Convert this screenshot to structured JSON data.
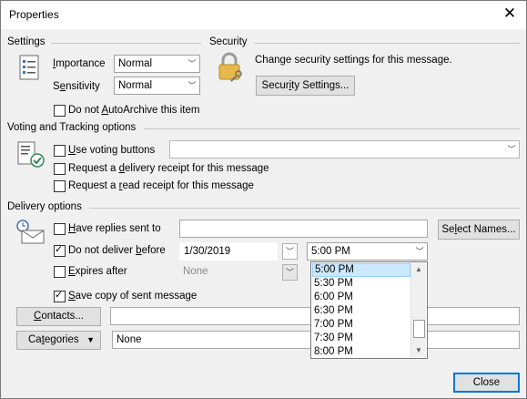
{
  "window": {
    "title": "Properties",
    "close_glyph": "✕"
  },
  "settings": {
    "heading": "Settings",
    "importance_pre": "",
    "importance_u": "I",
    "importance_post": "mportance",
    "importance_value": "Normal",
    "sensitivity_pre": "S",
    "sensitivity_u": "e",
    "sensitivity_post": "nsitivity",
    "sensitivity_value": "Normal",
    "autoarchive_pre": "Do not ",
    "autoarchive_u": "A",
    "autoarchive_post": "utoArchive this item",
    "autoarchive_checked": false
  },
  "security": {
    "heading": "Security",
    "description": "Change security settings for this message.",
    "button_pre": "Secur",
    "button_u": "i",
    "button_post": "ty Settings..."
  },
  "voting": {
    "heading": "Voting and Tracking options",
    "use_voting_pre": "",
    "use_voting_u": "U",
    "use_voting_post": "se voting buttons",
    "use_voting_checked": false,
    "voting_value": "",
    "delivery_receipt_pre": "Request a ",
    "delivery_receipt_u": "d",
    "delivery_receipt_post": "elivery receipt for this message",
    "delivery_receipt_checked": false,
    "read_receipt_pre": "Request a ",
    "read_receipt_u": "r",
    "read_receipt_post": "ead receipt for this message",
    "read_receipt_checked": false
  },
  "delivery": {
    "heading": "Delivery options",
    "replies_pre": "",
    "replies_u": "H",
    "replies_post": "ave replies sent to",
    "replies_checked": false,
    "replies_value": "",
    "select_names_pre": "Se",
    "select_names_u": "l",
    "select_names_post": "ect Names...",
    "deliver_before_pre": "Do not deliver ",
    "deliver_before_u": "b",
    "deliver_before_post": "efore",
    "deliver_before_checked": true,
    "deliver_date": "1/30/2019",
    "deliver_time": "5:00 PM",
    "expires_pre": "",
    "expires_u": "E",
    "expires_post": "xpires after",
    "expires_checked": false,
    "expires_date": "None",
    "save_copy_pre": "",
    "save_copy_u": "S",
    "save_copy_post": "ave copy of sent message",
    "save_copy_checked": true
  },
  "contacts": {
    "button_pre": "",
    "button_u": "C",
    "button_post": "ontacts...",
    "value": ""
  },
  "categories": {
    "button_pre": "Ca",
    "button_u": "t",
    "button_post": "egories",
    "value": "None"
  },
  "time_options": [
    "5:00 PM",
    "5:30 PM",
    "6:00 PM",
    "6:30 PM",
    "7:00 PM",
    "7:30 PM",
    "8:00 PM"
  ],
  "time_selected_index": 0,
  "footer": {
    "close_label": "Close"
  },
  "colors": {
    "selection": "#cce8ff",
    "accent": "#0078d7"
  }
}
